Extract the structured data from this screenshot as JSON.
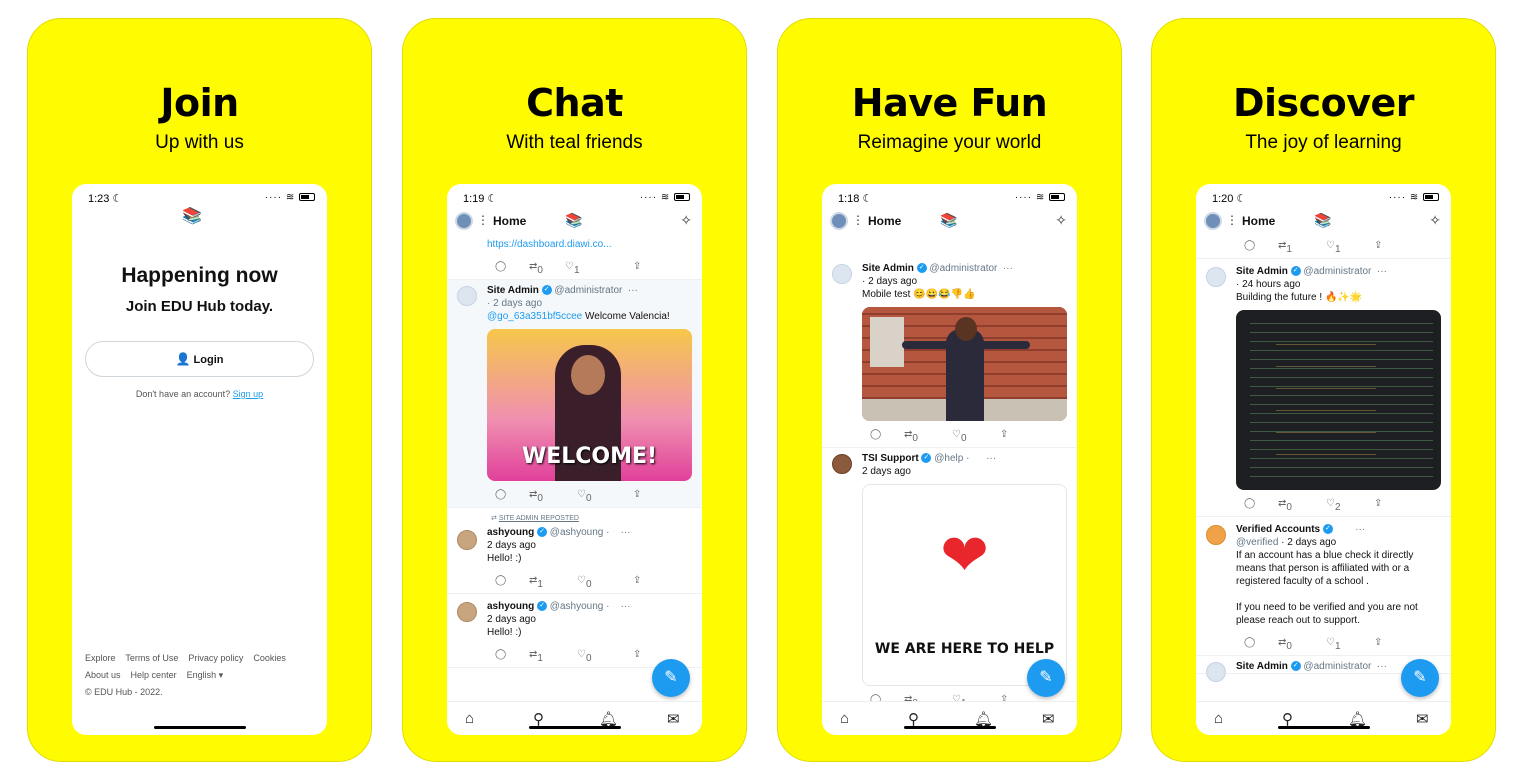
{
  "cards": [
    {
      "title": "Join",
      "subtitle": "Up with us"
    },
    {
      "title": "Chat",
      "subtitle": "With teal friends"
    },
    {
      "title": "Have Fun",
      "subtitle": "Reimagine your world"
    },
    {
      "title": "Discover",
      "subtitle": "The joy of learning"
    }
  ],
  "colors": {
    "card_bg": "#fffb00",
    "accent": "#1d9bf0"
  },
  "join": {
    "time": "1:23",
    "headline": "Happening now",
    "subhead": "Join EDU Hub today.",
    "login_label": "Login",
    "no_account": "Don't have an account?",
    "signup_label": "Sign up",
    "footer": {
      "links_row1": [
        "Explore",
        "Terms of Use",
        "Privacy policy",
        "Cookies"
      ],
      "links_row2": [
        "About us",
        "Help center",
        "English"
      ],
      "copyright": "© EDU Hub - 2022."
    }
  },
  "chat": {
    "time": "1:19",
    "home_label": "Home",
    "top_link": "https://dashboard.diawi.co...",
    "top_actions": {
      "retweets": "0",
      "likes": "1"
    },
    "post1": {
      "name": "Site Admin",
      "handle": "@administrator",
      "ago": "· 2 days ago",
      "mention": "@go_63a351bf5ccee",
      "text": "Welcome Valencia!",
      "gif_text": "WELCOME!",
      "retweets": "0",
      "likes": "0"
    },
    "repost_label": "SITE ADMIN REPOSTED",
    "post2": {
      "name": "ashyoung",
      "handle": "@ashyoung ·",
      "ago": "2 days ago",
      "text": "Hello! :)",
      "retweets": "1",
      "likes": "0"
    },
    "post3": {
      "name": "ashyoung",
      "handle": "@ashyoung ·",
      "ago": "2 days ago",
      "text": "Hello! :)",
      "retweets": "1",
      "likes": "0"
    }
  },
  "fun": {
    "time": "1:18",
    "home_label": "Home",
    "post1": {
      "name": "Site Admin",
      "handle": "@administrator",
      "ago": "· 2 days ago",
      "text": "Mobile test 😊😀😂👎👍",
      "retweets": "0",
      "likes": "0"
    },
    "post2": {
      "name": "TSI Support",
      "handle": "@help ·",
      "ago": "2 days ago",
      "image_text": "WE ARE HERE TO HELP",
      "retweets": "0",
      "likes": "1"
    }
  },
  "discover": {
    "time": "1:20",
    "home_label": "Home",
    "top_actions": {
      "retweets": "1",
      "likes": "1"
    },
    "post1": {
      "name": "Site Admin",
      "handle": "@administrator",
      "ago": "· 24 hours ago",
      "text": "Building the future ! 🔥✨🌟",
      "retweets": "0",
      "likes": "2"
    },
    "post2": {
      "name": "Verified Accounts",
      "handle": "@verified",
      "ago": "· 2 days ago",
      "text1": "If an account has a blue check it directly means that person is affiliated with or a registered faculty of a school .",
      "text2": "If you need to be verified and you are not please reach out to support.",
      "retweets": "0",
      "likes": "1"
    },
    "post3": {
      "name": "Site Admin",
      "handle": "@administrator"
    }
  }
}
